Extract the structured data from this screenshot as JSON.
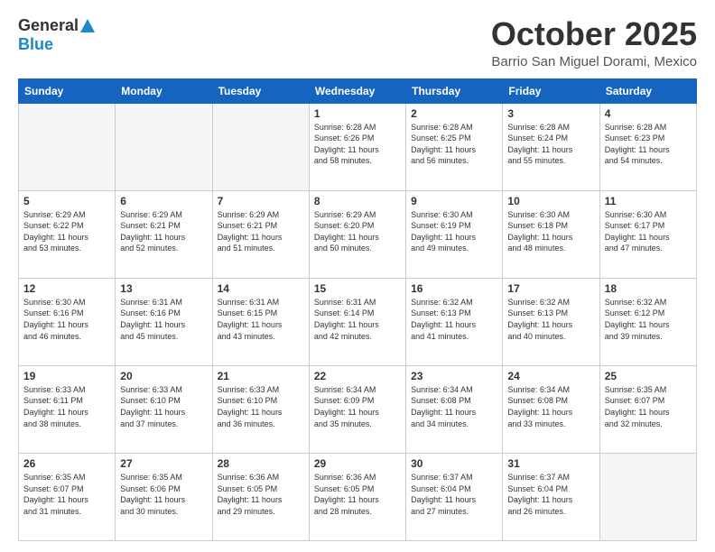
{
  "header": {
    "logo_general": "General",
    "logo_blue": "Blue",
    "month": "October 2025",
    "location": "Barrio San Miguel Dorami, Mexico"
  },
  "weekdays": [
    "Sunday",
    "Monday",
    "Tuesday",
    "Wednesday",
    "Thursday",
    "Friday",
    "Saturday"
  ],
  "weeks": [
    [
      {
        "day": "",
        "info": ""
      },
      {
        "day": "",
        "info": ""
      },
      {
        "day": "",
        "info": ""
      },
      {
        "day": "1",
        "info": "Sunrise: 6:28 AM\nSunset: 6:26 PM\nDaylight: 11 hours\nand 58 minutes."
      },
      {
        "day": "2",
        "info": "Sunrise: 6:28 AM\nSunset: 6:25 PM\nDaylight: 11 hours\nand 56 minutes."
      },
      {
        "day": "3",
        "info": "Sunrise: 6:28 AM\nSunset: 6:24 PM\nDaylight: 11 hours\nand 55 minutes."
      },
      {
        "day": "4",
        "info": "Sunrise: 6:28 AM\nSunset: 6:23 PM\nDaylight: 11 hours\nand 54 minutes."
      }
    ],
    [
      {
        "day": "5",
        "info": "Sunrise: 6:29 AM\nSunset: 6:22 PM\nDaylight: 11 hours\nand 53 minutes."
      },
      {
        "day": "6",
        "info": "Sunrise: 6:29 AM\nSunset: 6:21 PM\nDaylight: 11 hours\nand 52 minutes."
      },
      {
        "day": "7",
        "info": "Sunrise: 6:29 AM\nSunset: 6:21 PM\nDaylight: 11 hours\nand 51 minutes."
      },
      {
        "day": "8",
        "info": "Sunrise: 6:29 AM\nSunset: 6:20 PM\nDaylight: 11 hours\nand 50 minutes."
      },
      {
        "day": "9",
        "info": "Sunrise: 6:30 AM\nSunset: 6:19 PM\nDaylight: 11 hours\nand 49 minutes."
      },
      {
        "day": "10",
        "info": "Sunrise: 6:30 AM\nSunset: 6:18 PM\nDaylight: 11 hours\nand 48 minutes."
      },
      {
        "day": "11",
        "info": "Sunrise: 6:30 AM\nSunset: 6:17 PM\nDaylight: 11 hours\nand 47 minutes."
      }
    ],
    [
      {
        "day": "12",
        "info": "Sunrise: 6:30 AM\nSunset: 6:16 PM\nDaylight: 11 hours\nand 46 minutes."
      },
      {
        "day": "13",
        "info": "Sunrise: 6:31 AM\nSunset: 6:16 PM\nDaylight: 11 hours\nand 45 minutes."
      },
      {
        "day": "14",
        "info": "Sunrise: 6:31 AM\nSunset: 6:15 PM\nDaylight: 11 hours\nand 43 minutes."
      },
      {
        "day": "15",
        "info": "Sunrise: 6:31 AM\nSunset: 6:14 PM\nDaylight: 11 hours\nand 42 minutes."
      },
      {
        "day": "16",
        "info": "Sunrise: 6:32 AM\nSunset: 6:13 PM\nDaylight: 11 hours\nand 41 minutes."
      },
      {
        "day": "17",
        "info": "Sunrise: 6:32 AM\nSunset: 6:13 PM\nDaylight: 11 hours\nand 40 minutes."
      },
      {
        "day": "18",
        "info": "Sunrise: 6:32 AM\nSunset: 6:12 PM\nDaylight: 11 hours\nand 39 minutes."
      }
    ],
    [
      {
        "day": "19",
        "info": "Sunrise: 6:33 AM\nSunset: 6:11 PM\nDaylight: 11 hours\nand 38 minutes."
      },
      {
        "day": "20",
        "info": "Sunrise: 6:33 AM\nSunset: 6:10 PM\nDaylight: 11 hours\nand 37 minutes."
      },
      {
        "day": "21",
        "info": "Sunrise: 6:33 AM\nSunset: 6:10 PM\nDaylight: 11 hours\nand 36 minutes."
      },
      {
        "day": "22",
        "info": "Sunrise: 6:34 AM\nSunset: 6:09 PM\nDaylight: 11 hours\nand 35 minutes."
      },
      {
        "day": "23",
        "info": "Sunrise: 6:34 AM\nSunset: 6:08 PM\nDaylight: 11 hours\nand 34 minutes."
      },
      {
        "day": "24",
        "info": "Sunrise: 6:34 AM\nSunset: 6:08 PM\nDaylight: 11 hours\nand 33 minutes."
      },
      {
        "day": "25",
        "info": "Sunrise: 6:35 AM\nSunset: 6:07 PM\nDaylight: 11 hours\nand 32 minutes."
      }
    ],
    [
      {
        "day": "26",
        "info": "Sunrise: 6:35 AM\nSunset: 6:07 PM\nDaylight: 11 hours\nand 31 minutes."
      },
      {
        "day": "27",
        "info": "Sunrise: 6:35 AM\nSunset: 6:06 PM\nDaylight: 11 hours\nand 30 minutes."
      },
      {
        "day": "28",
        "info": "Sunrise: 6:36 AM\nSunset: 6:05 PM\nDaylight: 11 hours\nand 29 minutes."
      },
      {
        "day": "29",
        "info": "Sunrise: 6:36 AM\nSunset: 6:05 PM\nDaylight: 11 hours\nand 28 minutes."
      },
      {
        "day": "30",
        "info": "Sunrise: 6:37 AM\nSunset: 6:04 PM\nDaylight: 11 hours\nand 27 minutes."
      },
      {
        "day": "31",
        "info": "Sunrise: 6:37 AM\nSunset: 6:04 PM\nDaylight: 11 hours\nand 26 minutes."
      },
      {
        "day": "",
        "info": ""
      }
    ]
  ]
}
